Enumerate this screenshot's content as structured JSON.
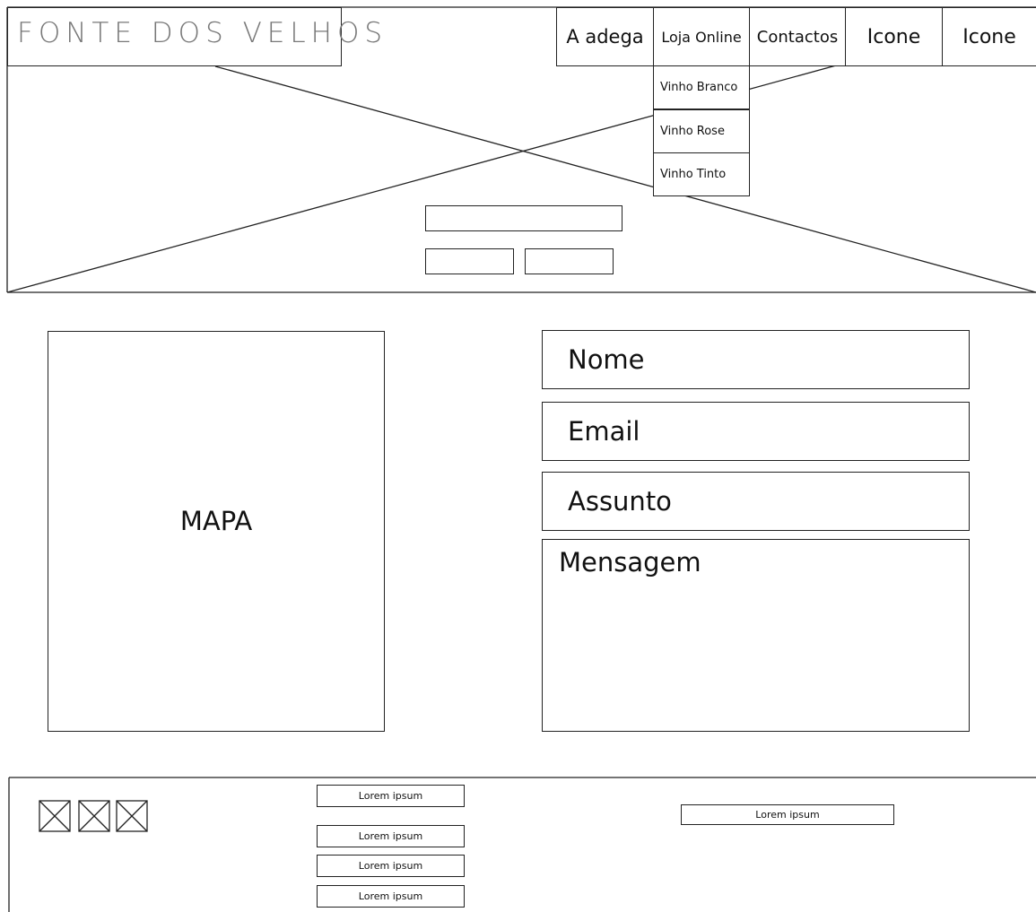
{
  "header": {
    "logo_text": "FONTE DOS VELHOS",
    "nav": {
      "a_adega": "A adega",
      "loja_online": "Loja Online",
      "contactos": "Contactos",
      "icon_1": "Icone",
      "icon_2": "Icone"
    },
    "dropdown": [
      "Vinho Branco",
      "Vinho Rose",
      "Vinho Tinto"
    ]
  },
  "contact": {
    "map_label": "MAPA",
    "fields": {
      "name": "Nome",
      "email": "Email",
      "subject": "Assunto",
      "message": "Mensagem"
    }
  },
  "footer": {
    "social_icons": [
      "placeholder-icon",
      "placeholder-icon",
      "placeholder-icon"
    ],
    "links": [
      "Lorem ipsum",
      "Lorem ipsum",
      "Lorem ipsum",
      "Lorem ipsum"
    ],
    "right_text": "Lorem ipsum"
  }
}
